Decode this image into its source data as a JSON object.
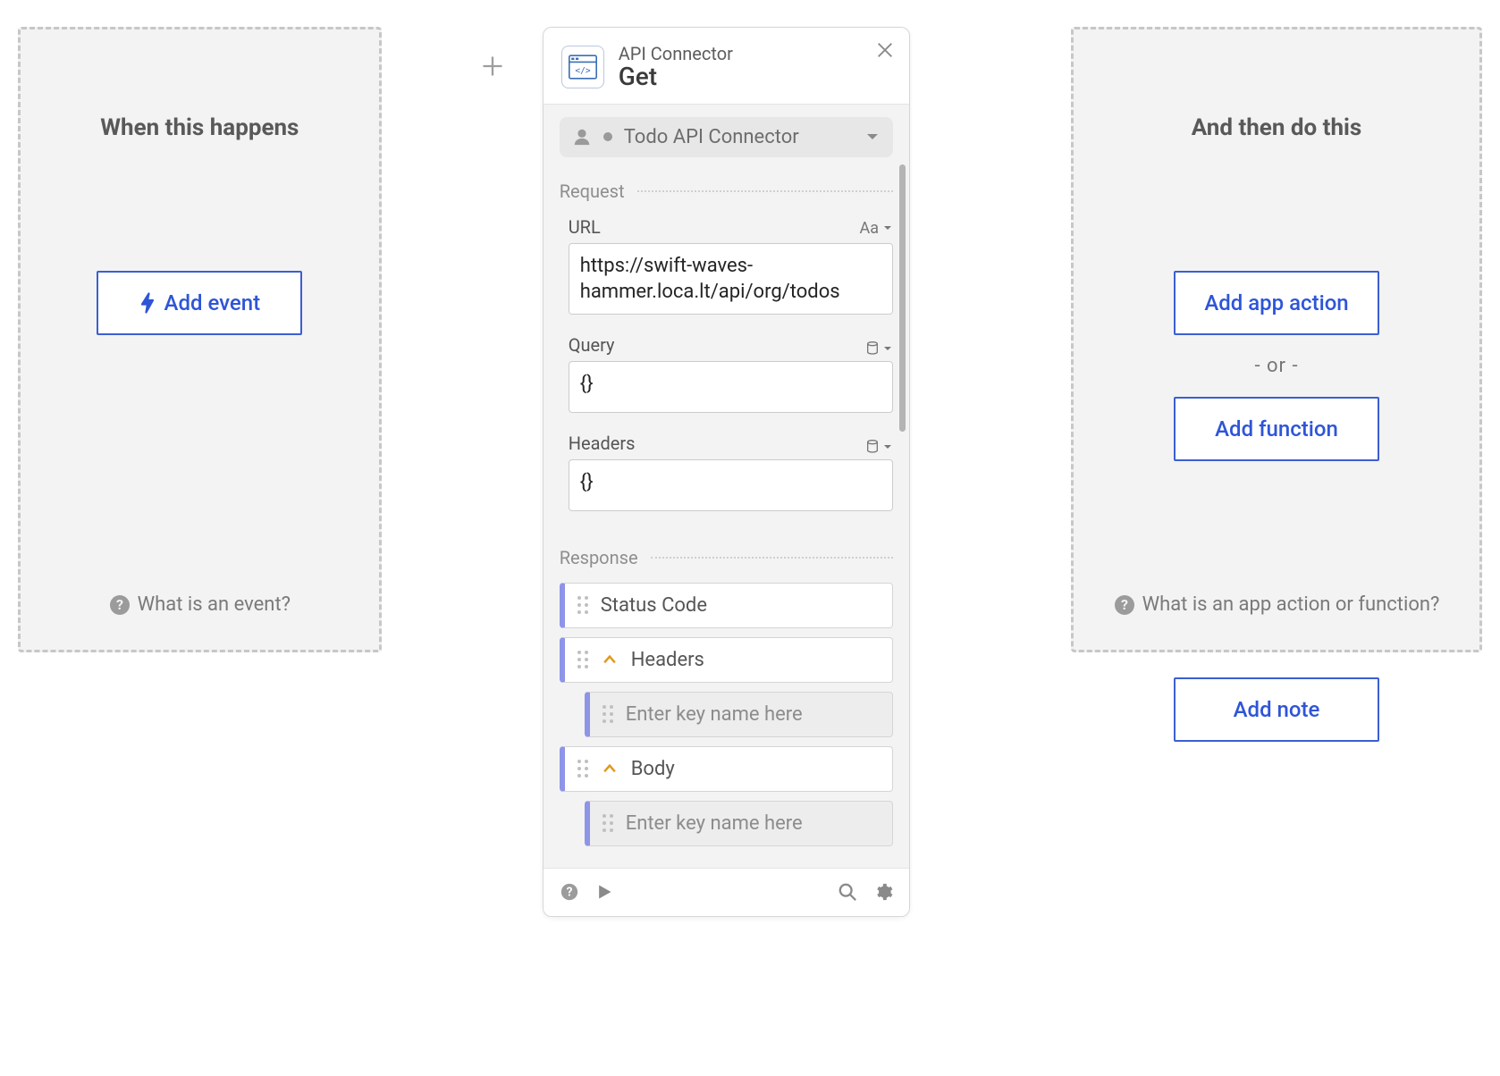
{
  "left": {
    "title": "When this happens",
    "add_event_label": "Add event",
    "help_label": "What is an event?"
  },
  "right": {
    "title": "And then do this",
    "add_app_action_label": "Add app action",
    "or_label": "- or -",
    "add_function_label": "Add function",
    "help_label": "What is an app action or function?",
    "add_note_label": "Add note"
  },
  "card": {
    "app_supertitle": "API Connector",
    "app_title": "Get",
    "scope_label": "Todo API Connector",
    "sections": {
      "request_label": "Request",
      "response_label": "Response"
    },
    "fields": {
      "url_label": "URL",
      "url_mode": "Aa",
      "url_value": "https://swift-waves-hammer.loca.lt/api/org/todos",
      "query_label": "Query",
      "query_value": "{}",
      "headers_label": "Headers",
      "headers_value": "{}"
    },
    "response": {
      "status_code_label": "Status Code",
      "headers_label": "Headers",
      "headers_key_placeholder": "Enter key name here",
      "body_label": "Body",
      "body_key_placeholder": "Enter key name here"
    }
  }
}
